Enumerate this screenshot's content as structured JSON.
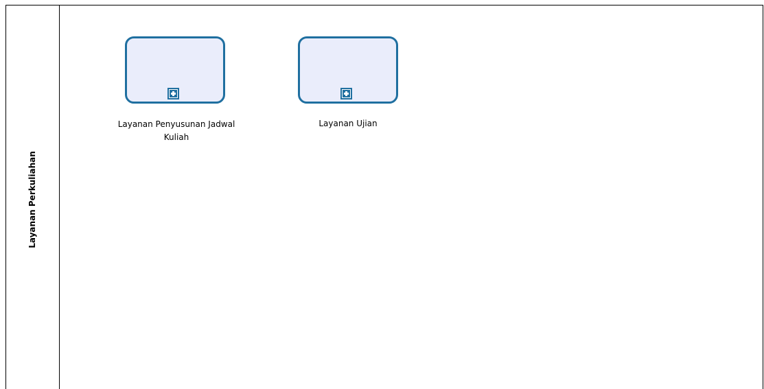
{
  "lane": {
    "label": "Layanan Perkuliahan"
  },
  "subprocesses": [
    {
      "label_line1": "Layanan Penyusunan Jadwal",
      "label_line2": "Kuliah",
      "marker_icon": "plus-icon"
    },
    {
      "label_line1": "Layanan Ujian",
      "marker_icon": "plus-icon"
    }
  ],
  "colors": {
    "task_border": "#1f6fa0",
    "task_fill": "#eaedfb",
    "lane_border": "#000000"
  }
}
